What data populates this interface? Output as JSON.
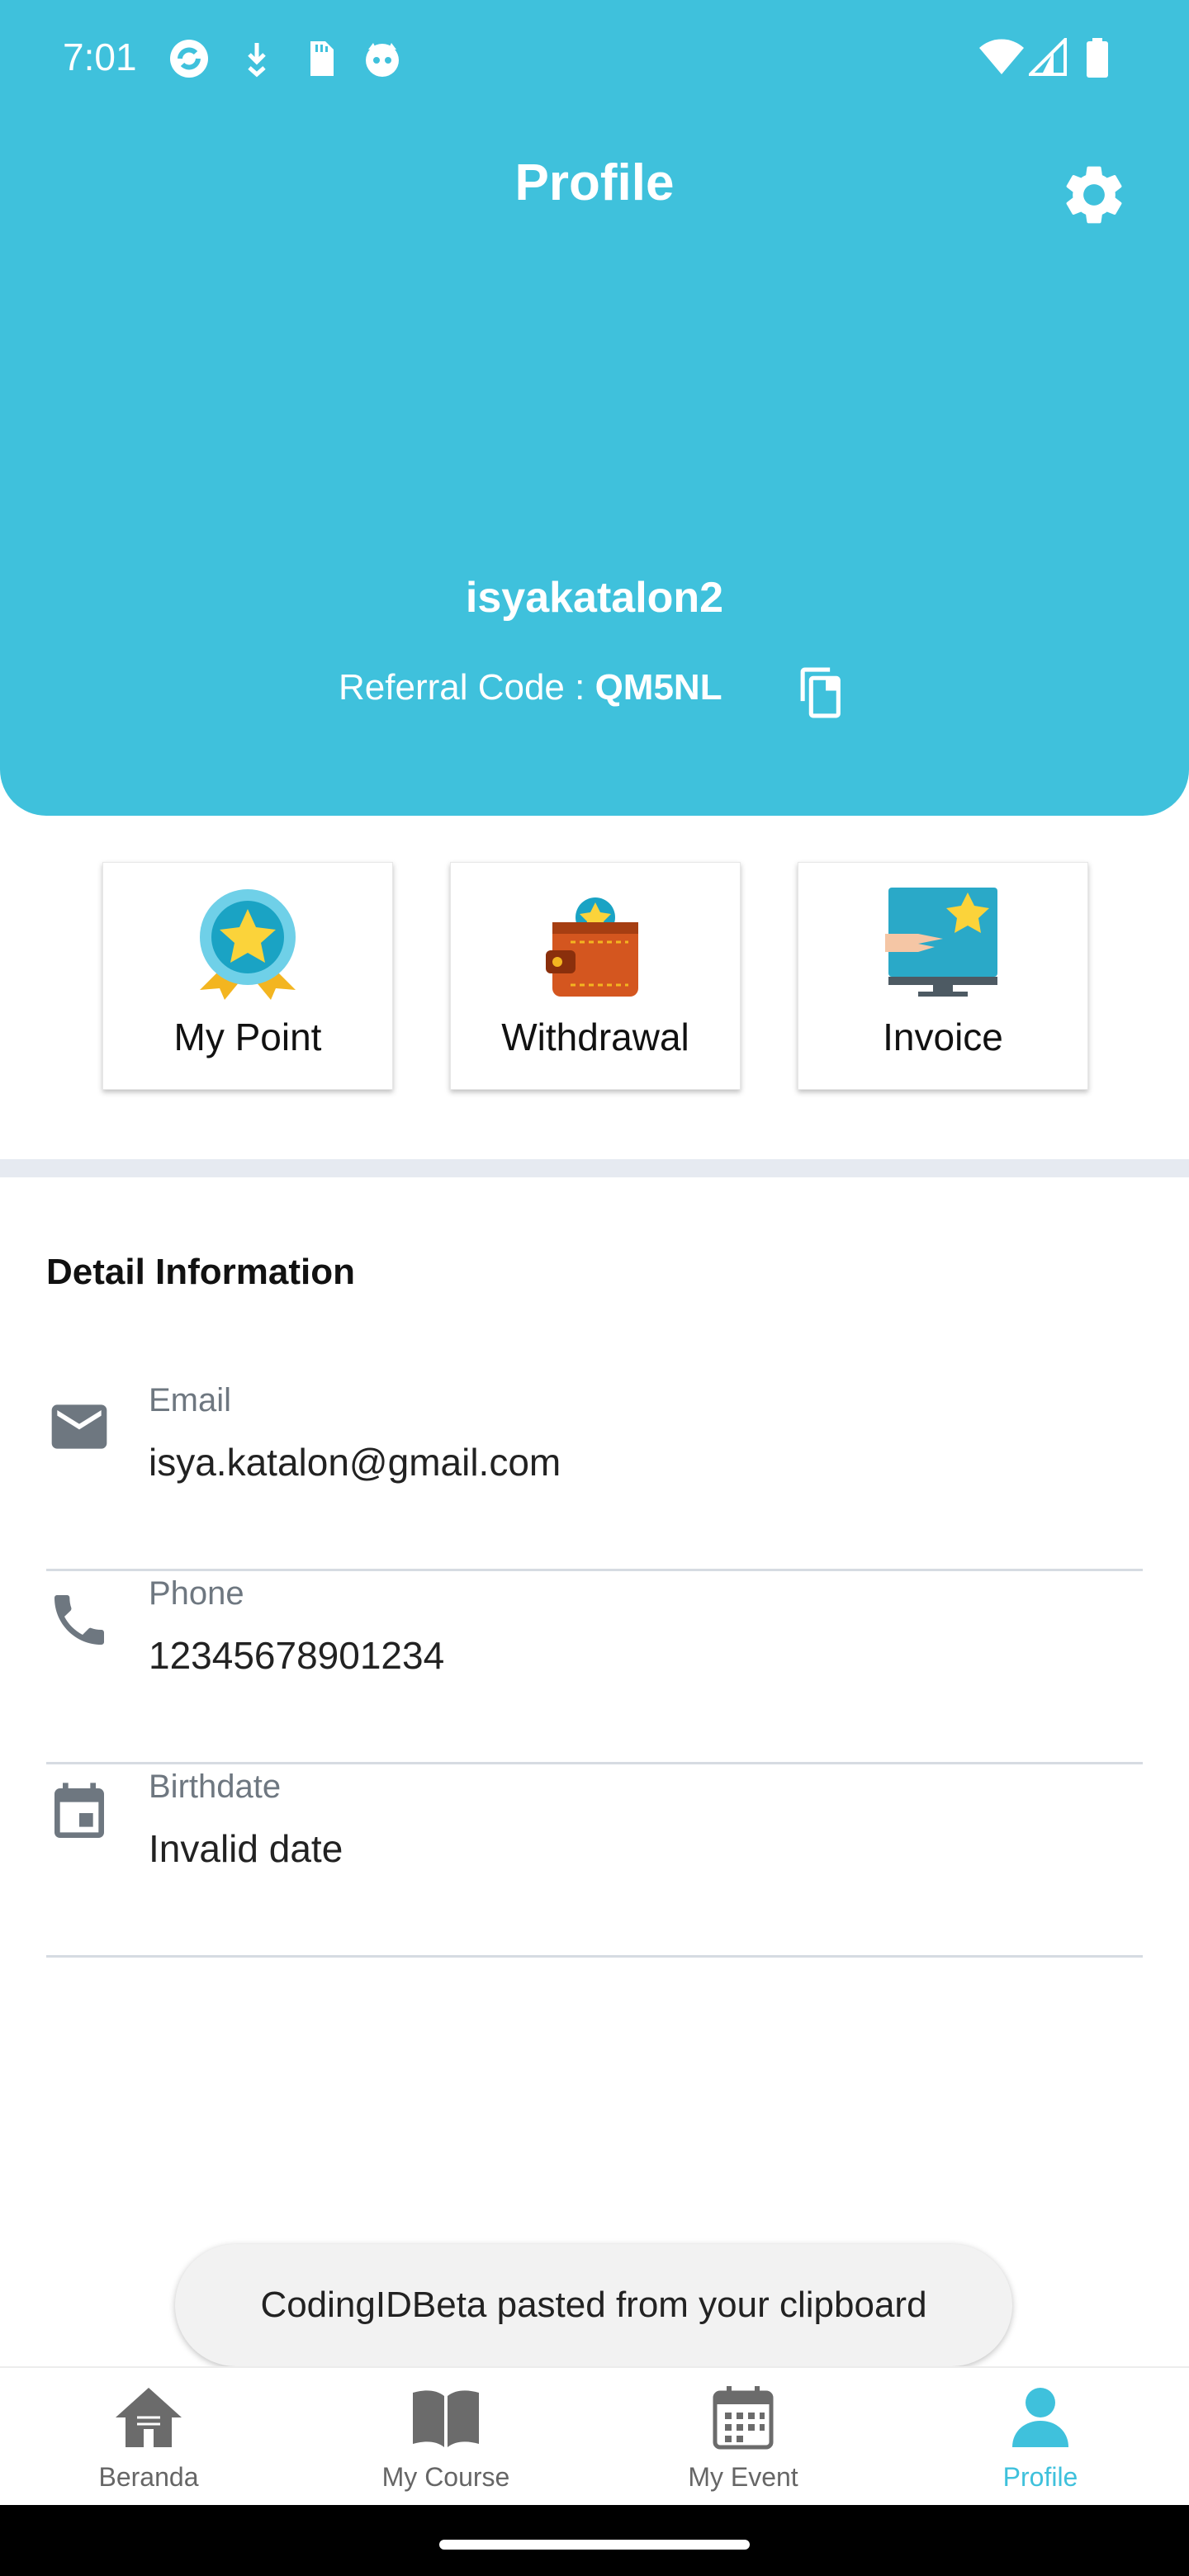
{
  "status_bar": {
    "time": "7:01",
    "left_icons": [
      "sync-app-icon",
      "download-arrow-icon",
      "sd-card-icon",
      "cat-face-icon"
    ],
    "right_icons": [
      "wifi-icon",
      "signal-icon",
      "battery-icon"
    ]
  },
  "header": {
    "title": "Profile",
    "username": "isyakatalon2",
    "referral_label": "Referral Code : ",
    "referral_code": "QM5NL",
    "accent_color": "#3fc1dc"
  },
  "quick_actions": [
    {
      "label": "My Point",
      "icon": "medal-star-icon"
    },
    {
      "label": "Withdrawal",
      "icon": "wallet-icon"
    },
    {
      "label": "Invoice",
      "icon": "monitor-star-icon"
    }
  ],
  "detail": {
    "section_title": "Detail Information",
    "rows": [
      {
        "label": "Email",
        "value": "isya.katalon@gmail.com",
        "icon": "email-icon"
      },
      {
        "label": "Phone",
        "value": "12345678901234",
        "icon": "phone-icon"
      },
      {
        "label": "Birthdate",
        "value": "Invalid date",
        "icon": "calendar-icon"
      }
    ]
  },
  "toast": {
    "text": "CodingIDBeta pasted from your clipboard"
  },
  "bottom_nav": [
    {
      "label": "Beranda",
      "icon": "home-icon",
      "active": false
    },
    {
      "label": "My Course",
      "icon": "book-icon",
      "active": false
    },
    {
      "label": "My Event",
      "icon": "calendar-grid-icon",
      "active": false
    },
    {
      "label": "Profile",
      "icon": "person-icon",
      "active": true
    }
  ]
}
